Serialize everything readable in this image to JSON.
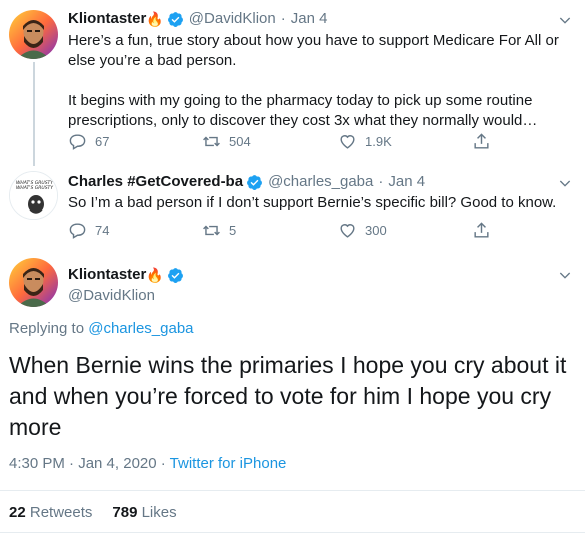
{
  "tweet1": {
    "name": "Kliontaster",
    "handle": "@DavidKlion",
    "sep": "·",
    "date": "Jan 4",
    "paragraph1": "Here’s a fun, true story about how you have to support Medicare For All or else you’re a bad person.",
    "paragraph2": "It begins with my going to the pharmacy today to pick up some routine prescriptions, only to discover they cost 3x what they normally would…",
    "replies": "67",
    "retweets": "504",
    "likes": "1.9K"
  },
  "tweet2": {
    "name": "Charles #GetCovered-ba",
    "handle": "@charles_gaba",
    "sep": "·",
    "date": "Jan 4",
    "text": "So I’m a bad person if I don’t support Bernie’s specific bill? Good to know.",
    "replies": "74",
    "retweets": "5",
    "likes": "300"
  },
  "main": {
    "name": "Kliontaster",
    "handle": "@DavidKlion",
    "replying_prefix": "Replying to",
    "replying_to": "@charles_gaba",
    "text": "When Bernie wins the primaries I hope you cry about it and when you’re forced to vote for him I hope you cry more",
    "time": "4:30 PM · Jan 4, 2020 ·",
    "source": "Twitter for iPhone",
    "retweet_count": "22",
    "retweet_label": "Retweets",
    "like_count": "789",
    "like_label": "Likes"
  },
  "colors": {
    "link": "#1b95e0",
    "muted": "#657786",
    "text": "#14171a",
    "verified": "#1da1f2",
    "border": "#e6ecf0"
  },
  "icons": [
    "fire-emoji",
    "verified-badge-icon",
    "reply-icon",
    "retweet-icon",
    "like-icon",
    "share-icon",
    "chevron-down-icon"
  ]
}
